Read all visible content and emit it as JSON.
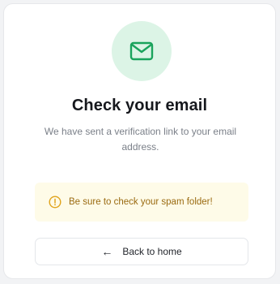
{
  "card": {
    "icon": "mail-icon",
    "title": "Check your email",
    "subtitle": "We have sent a verification link to your email address."
  },
  "notice": {
    "icon": "warning-circle-icon",
    "text": "Be sure to check your spam folder!"
  },
  "back_button": {
    "icon": "arrow-left-icon",
    "label": "Back to home"
  },
  "colors": {
    "accent_green": "#1aa35c",
    "icon_bg": "#dcf4e6",
    "notice_bg": "#fefbe8",
    "notice_text": "#9a6a10"
  }
}
